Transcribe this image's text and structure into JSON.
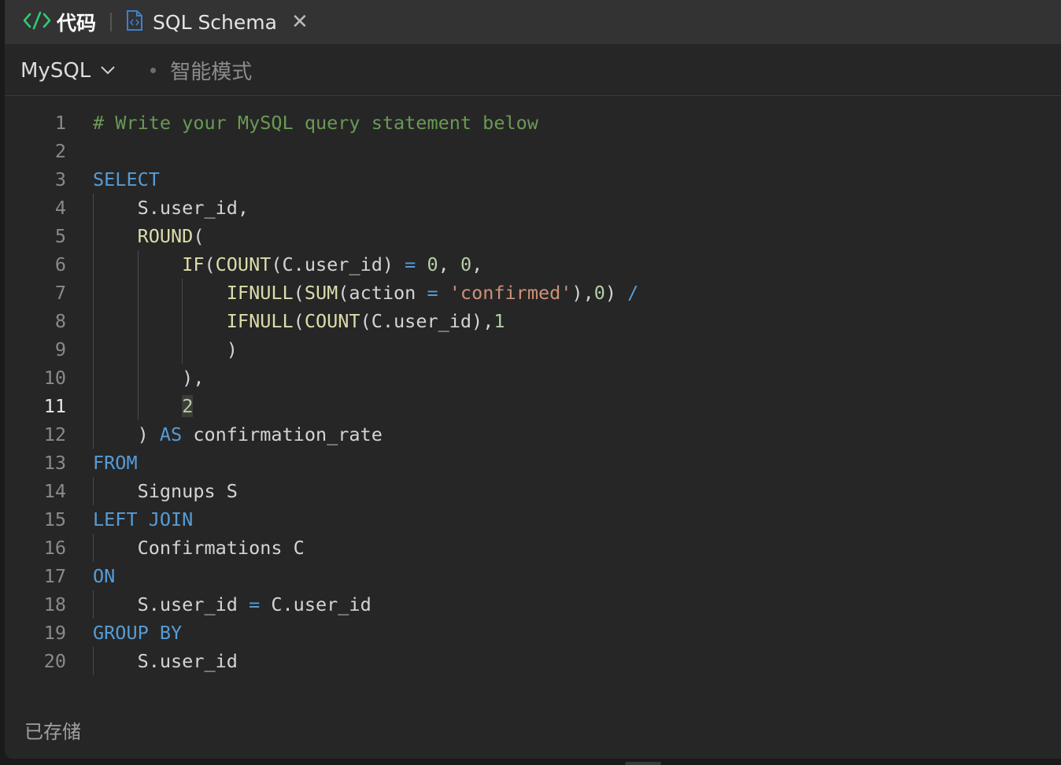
{
  "tabs": {
    "code_label": "代码",
    "schema_label": "SQL Schema",
    "close_glyph": "✕"
  },
  "toolbar": {
    "language": "MySQL",
    "smart_mode": "智能模式"
  },
  "status": "已存储",
  "editor": {
    "active_line": 11,
    "lines": [
      {
        "num": "1",
        "tokens": [
          {
            "t": "# Write your MySQL query statement below",
            "c": "cm"
          }
        ]
      },
      {
        "num": "2",
        "tokens": []
      },
      {
        "num": "3",
        "tokens": [
          {
            "t": "SELECT",
            "c": "kw"
          }
        ]
      },
      {
        "num": "4",
        "tokens": [
          {
            "t": "    S.user_id,",
            "c": ""
          }
        ]
      },
      {
        "num": "5",
        "tokens": [
          {
            "t": "    ",
            "c": ""
          },
          {
            "t": "ROUND",
            "c": "fn"
          },
          {
            "t": "(",
            "c": ""
          }
        ]
      },
      {
        "num": "6",
        "tokens": [
          {
            "t": "        ",
            "c": ""
          },
          {
            "t": "IF",
            "c": "fn"
          },
          {
            "t": "(",
            "c": ""
          },
          {
            "t": "COUNT",
            "c": "fn"
          },
          {
            "t": "(C.user_id) ",
            "c": ""
          },
          {
            "t": "=",
            "c": "op"
          },
          {
            "t": " ",
            "c": ""
          },
          {
            "t": "0",
            "c": "num"
          },
          {
            "t": ", ",
            "c": ""
          },
          {
            "t": "0",
            "c": "num"
          },
          {
            "t": ",",
            "c": ""
          }
        ]
      },
      {
        "num": "7",
        "tokens": [
          {
            "t": "            ",
            "c": ""
          },
          {
            "t": "IFNULL",
            "c": "fn"
          },
          {
            "t": "(",
            "c": ""
          },
          {
            "t": "SUM",
            "c": "fn"
          },
          {
            "t": "(action ",
            "c": ""
          },
          {
            "t": "=",
            "c": "op"
          },
          {
            "t": " ",
            "c": ""
          },
          {
            "t": "'confirmed'",
            "c": "str"
          },
          {
            "t": "),",
            "c": ""
          },
          {
            "t": "0",
            "c": "num"
          },
          {
            "t": ") ",
            "c": ""
          },
          {
            "t": "/",
            "c": "op"
          }
        ]
      },
      {
        "num": "8",
        "tokens": [
          {
            "t": "            ",
            "c": ""
          },
          {
            "t": "IFNULL",
            "c": "fn"
          },
          {
            "t": "(",
            "c": ""
          },
          {
            "t": "COUNT",
            "c": "fn"
          },
          {
            "t": "(C.user_id),",
            "c": ""
          },
          {
            "t": "1",
            "c": "num"
          }
        ]
      },
      {
        "num": "9",
        "tokens": [
          {
            "t": "            )",
            "c": ""
          }
        ]
      },
      {
        "num": "10",
        "tokens": [
          {
            "t": "        ),",
            "c": ""
          }
        ]
      },
      {
        "num": "11",
        "tokens": [
          {
            "t": "        ",
            "c": ""
          },
          {
            "t": "2",
            "c": "num hl"
          }
        ]
      },
      {
        "num": "12",
        "tokens": [
          {
            "t": "    ) ",
            "c": ""
          },
          {
            "t": "AS",
            "c": "kw"
          },
          {
            "t": " confirmation_rate",
            "c": ""
          }
        ]
      },
      {
        "num": "13",
        "tokens": [
          {
            "t": "FROM",
            "c": "kw"
          }
        ]
      },
      {
        "num": "14",
        "tokens": [
          {
            "t": "    Signups S",
            "c": ""
          }
        ]
      },
      {
        "num": "15",
        "tokens": [
          {
            "t": "LEFT JOIN",
            "c": "kw"
          }
        ]
      },
      {
        "num": "16",
        "tokens": [
          {
            "t": "    Confirmations C",
            "c": ""
          }
        ]
      },
      {
        "num": "17",
        "tokens": [
          {
            "t": "ON",
            "c": "kw"
          }
        ]
      },
      {
        "num": "18",
        "tokens": [
          {
            "t": "    S.user_id ",
            "c": ""
          },
          {
            "t": "=",
            "c": "op"
          },
          {
            "t": " C.user_id",
            "c": ""
          }
        ]
      },
      {
        "num": "19",
        "tokens": [
          {
            "t": "GROUP BY",
            "c": "kw"
          }
        ]
      },
      {
        "num": "20",
        "tokens": [
          {
            "t": "    S.user_id",
            "c": ""
          }
        ]
      }
    ]
  }
}
